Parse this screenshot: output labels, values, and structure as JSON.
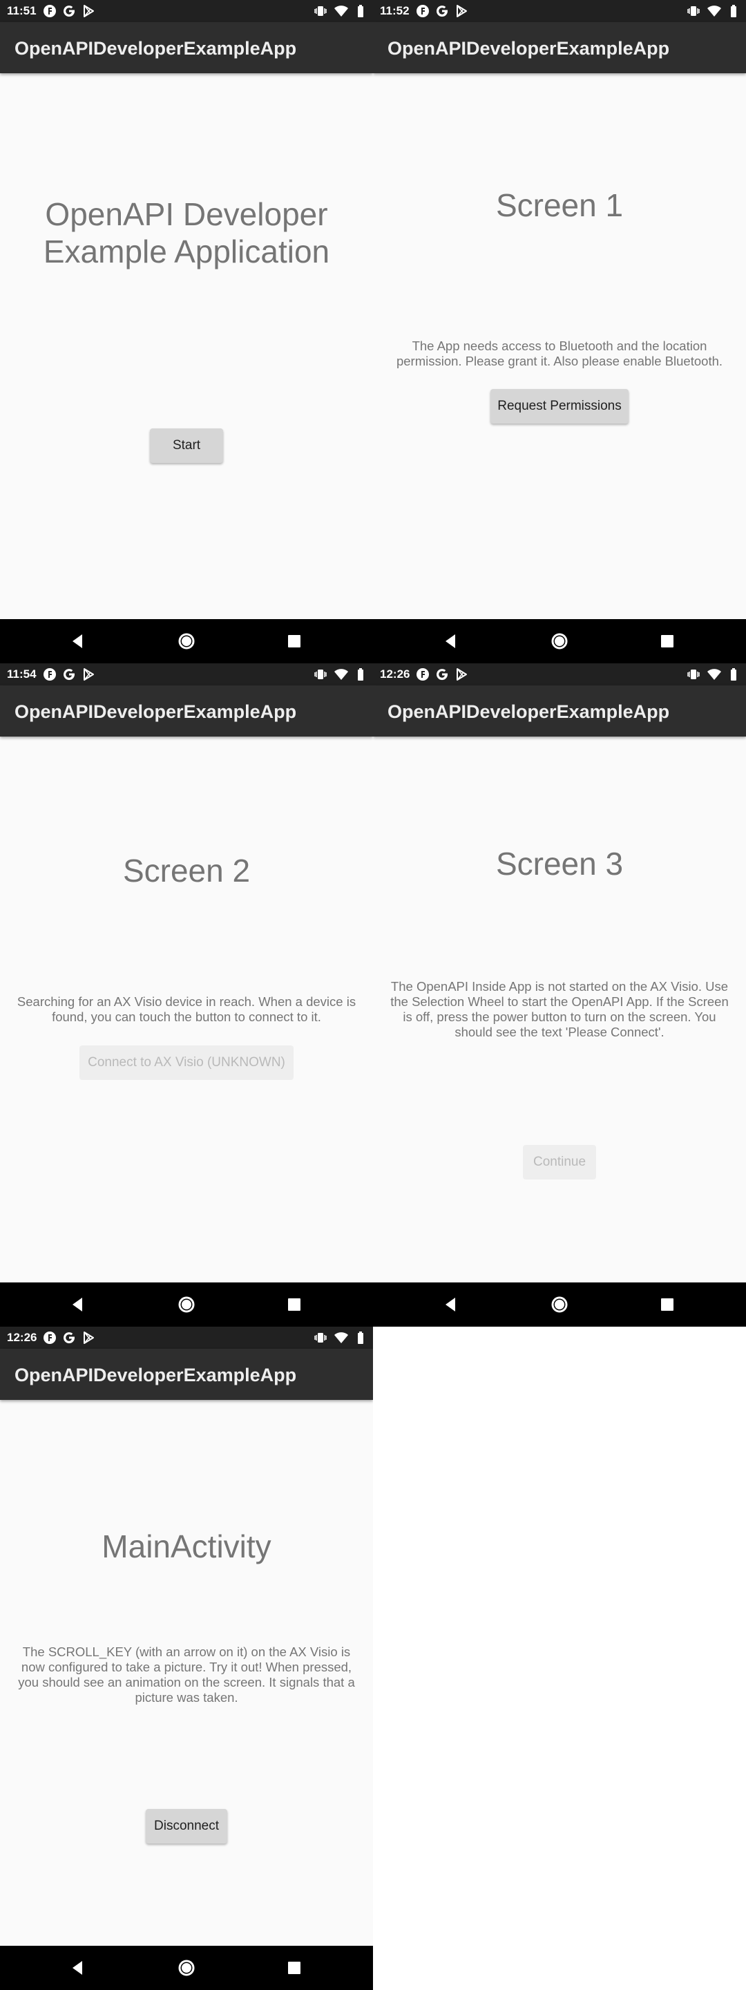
{
  "app_title": "OpenAPIDeveloperExampleApp",
  "colors": {
    "status_bar": "#212121",
    "app_bar": "#2e2e2e",
    "background": "#fafafa",
    "nav_bar": "#000000",
    "text_gray": "#757575",
    "button": "#d6d6d6"
  },
  "status_icons": {
    "left": [
      "app-f-icon",
      "google-icon",
      "play-store-icon"
    ],
    "right": [
      "vibrate-icon",
      "wifi-icon",
      "battery-icon"
    ]
  },
  "nav_icons": [
    "back-icon",
    "home-icon",
    "recents-icon"
  ],
  "screens": [
    {
      "time": "11:51",
      "heading": "OpenAPI Developer Example Application",
      "body": "",
      "button": "Start",
      "button_enabled": true
    },
    {
      "time": "11:52",
      "heading": "Screen 1",
      "body": "The App needs access to Bluetooth and the location permission. Please grant it. Also please enable Bluetooth.",
      "button": "Request Permissions",
      "button_enabled": true
    },
    {
      "time": "11:54",
      "heading": "Screen 2",
      "body": "Searching for an AX Visio device in reach. When a device is found, you can touch the button to connect to it.",
      "button": "Connect to AX Visio (UNKNOWN)",
      "button_enabled": false
    },
    {
      "time": "12:26",
      "heading": "Screen 3",
      "body": "The OpenAPI Inside App is not started on the AX Visio. Use the Selection Wheel to start the OpenAPI App. If the Screen is off, press the power button to turn on the screen. You should see the text 'Please Connect'.",
      "button": "Continue",
      "button_enabled": false
    },
    {
      "time": "12:26",
      "heading": "MainActivity",
      "body": "The SCROLL_KEY (with an arrow on it) on the AX Visio is now configured to take a picture. Try it out! When pressed, you should see an animation on the screen. It signals that a picture was taken.",
      "button": "Disconnect",
      "button_enabled": true
    }
  ]
}
